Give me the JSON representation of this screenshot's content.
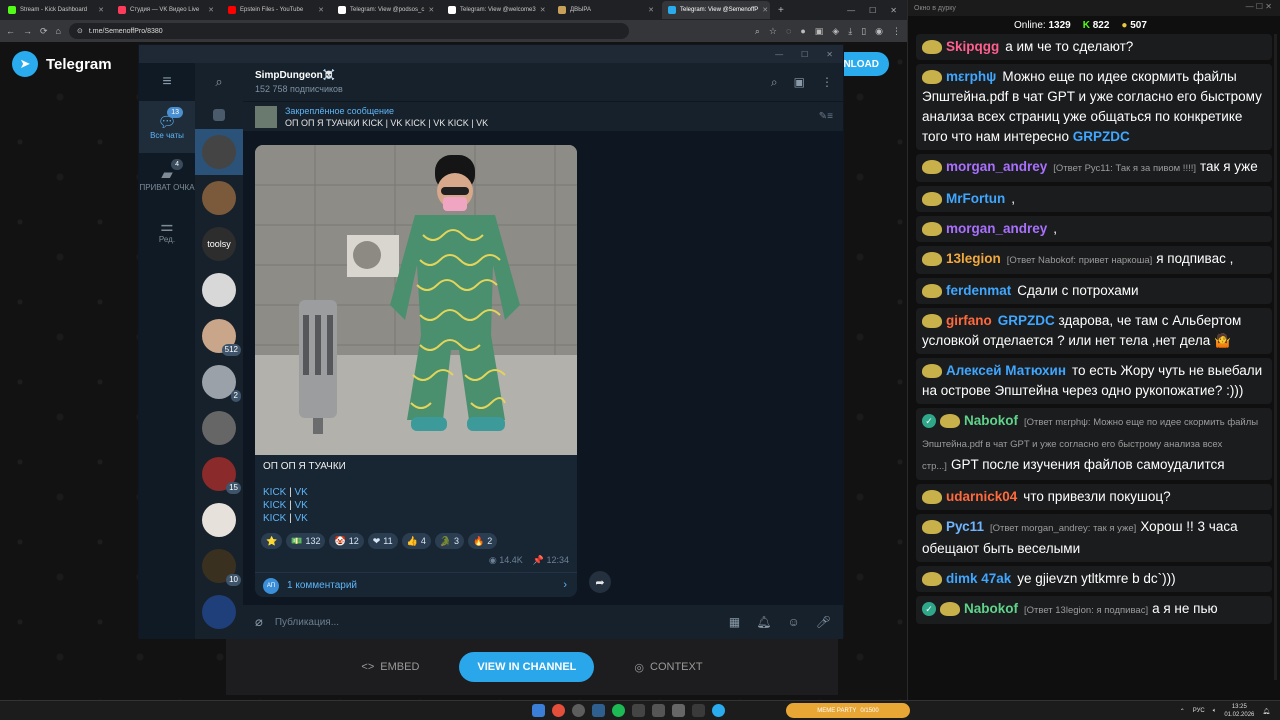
{
  "browser": {
    "tabs": [
      {
        "title": "Stream - Kick Dashboard",
        "color": "#53fc18"
      },
      {
        "title": "Студия — VK Видео Live",
        "color": "#ff3b5c"
      },
      {
        "title": "Epstein Files - YouTube",
        "color": "#ff0000"
      },
      {
        "title": "Telegram: View @podsos_c",
        "color": "#ffffff"
      },
      {
        "title": "Telegram: View @welcome3",
        "color": "#ffffff"
      },
      {
        "title": "ДВЫРА",
        "color": "#c8a058"
      },
      {
        "title": "Telegram: View @SemenoffP",
        "color": "#2aabee"
      }
    ],
    "new_tab": "+",
    "url": "t.me/SemenoffPro/8380"
  },
  "telegram_web": {
    "title": "Telegram",
    "download": "NLOAD",
    "embed": "EMBED",
    "view_in_channel": "VIEW IN CHANNEL",
    "context": "CONTEXT"
  },
  "tg": {
    "folders": [
      {
        "label": "Все чаты",
        "badge": "13",
        "icon": "chat-bubble-icon"
      },
      {
        "label": "ПРИВАТ ОЧКА",
        "badge": "4",
        "icon": "folder-icon"
      },
      {
        "label": "Ред.",
        "badge": "",
        "icon": "sliders-icon"
      }
    ],
    "avatars": [
      {
        "label": "",
        "color": "#444",
        "badge": ""
      },
      {
        "label": "",
        "color": "#7b5a3c",
        "badge": ""
      },
      {
        "label": "toolsy",
        "color": "#2d2d2d",
        "badge": ""
      },
      {
        "label": "",
        "color": "#d8d8d8",
        "badge": ""
      },
      {
        "label": "",
        "color": "#c9a58a",
        "badge": "512"
      },
      {
        "label": "",
        "color": "#9aa1a8",
        "badge": "2"
      },
      {
        "label": "",
        "color": "#666",
        "badge": ""
      },
      {
        "label": "",
        "color": "#8b2a2a",
        "badge": "15"
      },
      {
        "label": "",
        "color": "#e7e1dc",
        "badge": ""
      },
      {
        "label": "",
        "color": "#3a3020",
        "badge": "10"
      },
      {
        "label": "",
        "color": "#1f3f7a",
        "badge": ""
      }
    ],
    "channel_name": "SimpDungeon☠️",
    "subscribers": "152 758 подписчиков",
    "pinned_title": "Закреплённое сообщение",
    "pinned_text": "ОП ОП Я ТУАЧКИ  KICK | VK KICK | VK KICK | VK",
    "caption_title": "ОП ОП Я ТУАЧКИ",
    "caption_lines": [
      {
        "a": "KICK",
        "sep": " | ",
        "b": "VK"
      },
      {
        "a": "KICK",
        "sep": " | ",
        "b": "VK"
      },
      {
        "a": "KICK",
        "sep": " | ",
        "b": "VK"
      }
    ],
    "reactions": [
      {
        "emoji": "⭐",
        "count": ""
      },
      {
        "emoji": "💵",
        "count": "132"
      },
      {
        "emoji": "🤡",
        "count": "12"
      },
      {
        "emoji": "❤",
        "count": "11"
      },
      {
        "emoji": "👍",
        "count": "4"
      },
      {
        "emoji": "🐊",
        "count": "3"
      },
      {
        "emoji": "🔥",
        "count": "2"
      }
    ],
    "views": "14.4K",
    "time": "12:34",
    "comments": "1 комментарий",
    "comment_avatar": "АП",
    "composer_placeholder": "Публикация..."
  },
  "stream_chat": {
    "window_title": "Окно в дурку",
    "online_label": "Online:",
    "online": "1329",
    "stat2": "822",
    "stat3": "507",
    "messages": [
      {
        "user": "Skipqgg",
        "user_color": "#ff5f8f",
        "reply": "",
        "text": "а им че то сделают?"
      },
      {
        "user": "mεrphψ",
        "user_color": "#3fa7ff",
        "reply": "",
        "text": "Можно еще по идее скормить файлы Эпштейна.pdf в чат GPT и уже согласно его быстрому анализа всех страниц уже общаться по конкретике того что нам интересно",
        "mention": "GRPZDC"
      },
      {
        "user": "morgan_andrey",
        "user_color": "#a970ff",
        "reply": "[Ответ Рус11: Так я за пивом !!!!]",
        "text": "так я уже"
      },
      {
        "user": "MrFortun",
        "user_color": "#3fa7ff",
        "reply": "",
        "text": ","
      },
      {
        "user": "morgan_andrey",
        "user_color": "#a970ff",
        "reply": "",
        "text": ","
      },
      {
        "user": "13legion",
        "user_color": "#f2a93b",
        "reply": "[Ответ Nabokof: привет наркоша]",
        "text": "я подпивас ,"
      },
      {
        "user": "ferdenmat",
        "user_color": "#3fa7ff",
        "reply": "",
        "text": "Сдали с потрохами"
      },
      {
        "user": "girfano",
        "user_color": "#ff6a3d",
        "reply": "",
        "mention": "GRPZDC",
        "text": "здарова, че там с Альбертом условкой отделается ? или нет тела ,нет дела 🤷"
      },
      {
        "user": "Алексей Матюхин",
        "user_color": "#3fa7ff",
        "reply": "",
        "text": "то есть Жору чуть не выебали на острове Эпштейна через одно рукопожатие? :)))"
      },
      {
        "user": "Nabokof",
        "user_color": "#5fd38a",
        "reply": "[Ответ mεrphψ: Можно еще по идее скормить файлы Эпштейна.pdf в чат GPT и уже согласно его быстрому анализа всех стр...]",
        "text": "GPT после изучения файлов самоудалится"
      },
      {
        "user": "udarnick04",
        "user_color": "#ff6a3d",
        "reply": "",
        "text": "что привезли покушоц?"
      },
      {
        "user": "Рус11",
        "user_color": "#6fb6ff",
        "reply": "[Ответ morgan_andrey: так я уже]",
        "text": "Хорош !! 3 часа обещают быть веселыми"
      },
      {
        "user": "dimk 47ak",
        "user_color": "#3fa7ff",
        "reply": "",
        "text": "ye gjievzn ytltkmre b dc`)))"
      },
      {
        "user": "Nabokof",
        "user_color": "#5fd38a",
        "reply": "[Ответ 13legion: я подпивас]",
        "text": "а я не пью"
      }
    ]
  },
  "taskbar": {
    "meme": "MEME PARTY",
    "meme_progress": "0/1500",
    "lang": "РУС",
    "time": "13:25",
    "date": "01.02.2026"
  }
}
